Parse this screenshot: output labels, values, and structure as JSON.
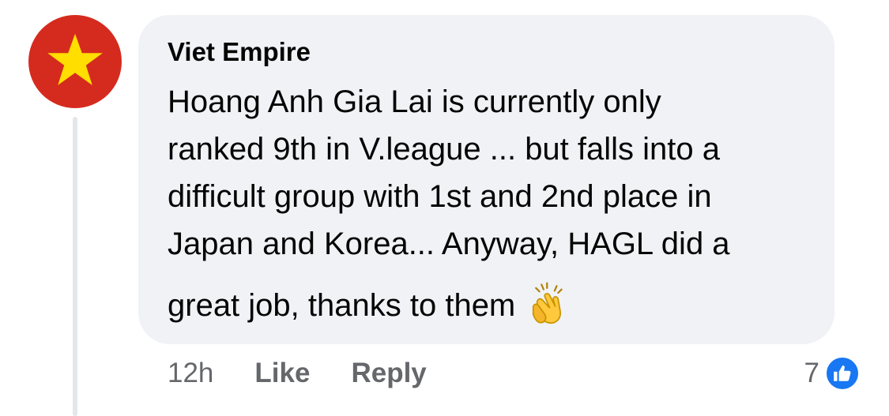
{
  "comment": {
    "author": "Viet Empire",
    "avatar_icon": "vietnam-flag-star-icon",
    "avatar_colors": {
      "background": "#d52b1e",
      "star": "#ffde00"
    },
    "text_lines": [
      "Hoang Anh Gia Lai is currently only",
      "ranked 9th in V.league ... but falls into a",
      "difficult group with 1st and 2nd place in",
      "Japan and Korea... Anyway, HAGL did a"
    ],
    "last_line": "great job, thanks to them",
    "emoji_icon": "clapping-hands-icon"
  },
  "actions": {
    "timestamp": "12h",
    "like_label": "Like",
    "reply_label": "Reply"
  },
  "reactions": {
    "count": "7",
    "icon": "like-thumb-icon",
    "badge_color": "#1877f2"
  }
}
